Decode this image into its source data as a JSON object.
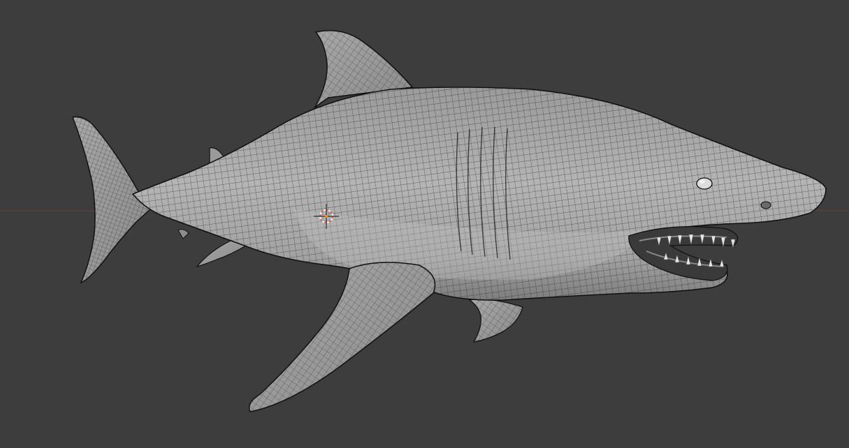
{
  "viewport": {
    "background": "#3d3d3d",
    "axis_color": "#7a4242",
    "mesh_color": "#a9a9a9",
    "wire_color": "#1e1e1e"
  },
  "scene": {
    "object": "shark-model",
    "display_mode": "solid-with-wireframe",
    "cursor_icon": "3d-cursor-icon"
  }
}
